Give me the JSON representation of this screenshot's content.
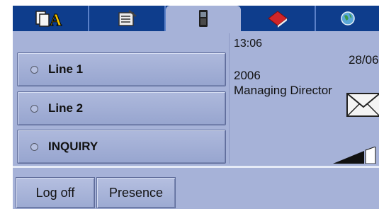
{
  "tabs": [
    {
      "icon": "contacts-icon",
      "active": false
    },
    {
      "icon": "notes-icon",
      "active": false
    },
    {
      "icon": "phone-icon",
      "active": true
    },
    {
      "icon": "book-icon",
      "active": false
    },
    {
      "icon": "globe-icon",
      "active": false
    }
  ],
  "lines": [
    {
      "label": "Line 1"
    },
    {
      "label": "Line 2"
    },
    {
      "label": "INQUIRY"
    }
  ],
  "info": {
    "time": "13:06",
    "date": "28/06",
    "year": "2006",
    "role": "Managing Director"
  },
  "footer": {
    "logoff_label": "Log off",
    "presence_label": "Presence"
  },
  "colors": {
    "tabbar": "#0e3d8c",
    "panel": "#a6b2d8"
  }
}
